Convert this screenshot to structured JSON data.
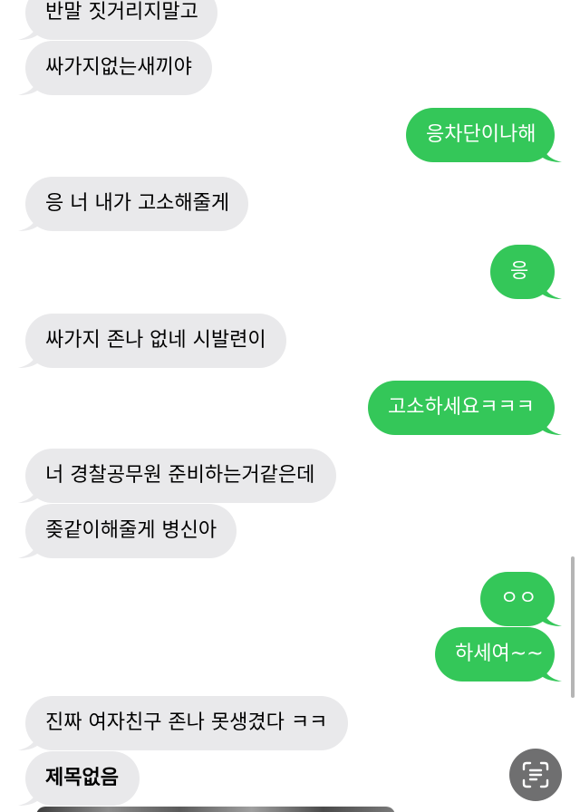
{
  "conversation": {
    "messages": [
      {
        "direction": "in",
        "text": "반말 짓거리지말고"
      },
      {
        "direction": "in",
        "text": "싸가지없는새끼야"
      },
      {
        "direction": "out",
        "text": "응차단이나해"
      },
      {
        "direction": "in",
        "text": "응 너 내가 고소해줄게"
      },
      {
        "direction": "out",
        "text": "응"
      },
      {
        "direction": "in",
        "text": "싸가지 존나 없네 시발련이"
      },
      {
        "direction": "out",
        "text": "고소하세요ㅋㅋㅋ"
      },
      {
        "direction": "in",
        "text": "너 경찰공무원 준비하는거같은데"
      },
      {
        "direction": "in",
        "text": "좆같이해줄게 병신아"
      },
      {
        "direction": "out",
        "text": "ㅇㅇ"
      },
      {
        "direction": "out",
        "text": "하세여~~"
      },
      {
        "direction": "in",
        "text": "진짜 여자친구 존나 못생겼다 ㅋㅋ"
      },
      {
        "direction": "in",
        "text": "제목없음"
      }
    ]
  },
  "colors": {
    "incoming_bubble": "#e9e9eb",
    "outgoing_bubble": "#34c759",
    "background": "#ffffff"
  },
  "icons": {
    "live_text": "live-text-icon"
  }
}
